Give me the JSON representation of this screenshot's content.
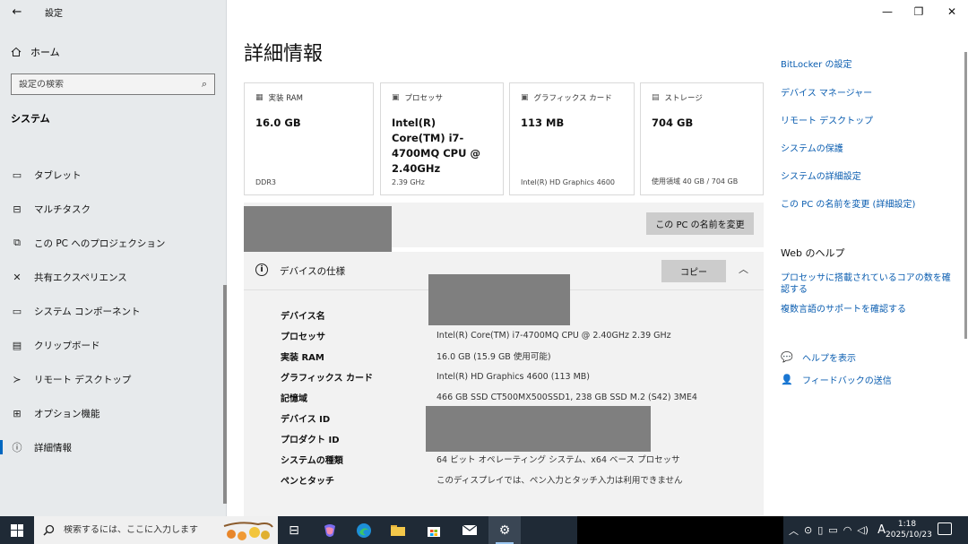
{
  "window": {
    "title": "設定",
    "back_icon": "←",
    "minimize": "—",
    "restore": "❐",
    "close": "✕"
  },
  "sidebar": {
    "home_label": "ホーム",
    "search_placeholder": "設定の検索",
    "section_label": "システム",
    "items": [
      {
        "label": "タブレット",
        "icon": "tablet-icon"
      },
      {
        "label": "マルチタスク",
        "icon": "multitask-icon"
      },
      {
        "label": "この PC へのプロジェクション",
        "icon": "projection-icon"
      },
      {
        "label": "共有エクスペリエンス",
        "icon": "shared-experience-icon"
      },
      {
        "label": "システム コンポーネント",
        "icon": "system-component-icon"
      },
      {
        "label": "クリップボード",
        "icon": "clipboard-icon"
      },
      {
        "label": "リモート デスクトップ",
        "icon": "remote-desktop-icon"
      },
      {
        "label": "オプション機能",
        "icon": "optional-features-icon"
      },
      {
        "label": "詳細情報",
        "icon": "info-icon",
        "active": true
      }
    ]
  },
  "main": {
    "title": "詳細情報",
    "cards": [
      {
        "label": "実装 RAM",
        "value": "16.0 GB",
        "foot": "DDR3",
        "icon": "ram-icon"
      },
      {
        "label": "プロセッサ",
        "value": "Intel(R) Core(TM) i7-4700MQ CPU @ 2.40GHz",
        "foot": "2.39 GHz",
        "icon": "processor-icon"
      },
      {
        "label": "グラフィックス カード",
        "value": "113 MB",
        "foot": "Intel(R) HD Graphics 4600",
        "icon": "graphics-card-icon"
      },
      {
        "label": "ストレージ",
        "value": "704 GB",
        "foot": "使用領域 40 GB / 704 GB",
        "icon": "storage-icon"
      }
    ],
    "rename_button": "この PC の名前を変更",
    "spec": {
      "title": "デバイスの仕様",
      "copy_button": "コピー",
      "rows": [
        {
          "key": "デバイス名",
          "value": ""
        },
        {
          "key": "プロセッサ",
          "value": "Intel(R) Core(TM) i7-4700MQ CPU @ 2.40GHz   2.39 GHz"
        },
        {
          "key": "実装 RAM",
          "value": "16.0 GB (15.9 GB 使用可能)"
        },
        {
          "key": "グラフィックス カード",
          "value": "Intel(R) HD Graphics 4600 (113 MB)"
        },
        {
          "key": "記憶域",
          "value": "466 GB SSD CT500MX500SSD1, 238 GB SSD M.2 (S42) 3ME4"
        },
        {
          "key": "デバイス ID",
          "value": ""
        },
        {
          "key": "プロダクト ID",
          "value": ""
        },
        {
          "key": "システムの種類",
          "value": "64 ビット オペレーティング システム、x64 ベース プロセッサ"
        },
        {
          "key": "ペンとタッチ",
          "value": "このディスプレイでは、ペン入力とタッチ入力は利用できません"
        }
      ]
    }
  },
  "right": {
    "links": [
      "BitLocker の設定",
      "デバイス マネージャー",
      "リモート デスクトップ",
      "システムの保護",
      "システムの詳細設定",
      "この PC の名前を変更 (詳細設定)"
    ],
    "web_help_heading": "Web のヘルプ",
    "web_links": [
      "プロセッサに搭載されているコアの数を確認する",
      "複数言語のサポートを確認する"
    ],
    "help": "ヘルプを表示",
    "feedback": "フィードバックの送信"
  },
  "taskbar": {
    "search_placeholder": "検索するには、ここに入力します",
    "time": "1:18",
    "date": "2025/10/23",
    "ime": "A"
  }
}
